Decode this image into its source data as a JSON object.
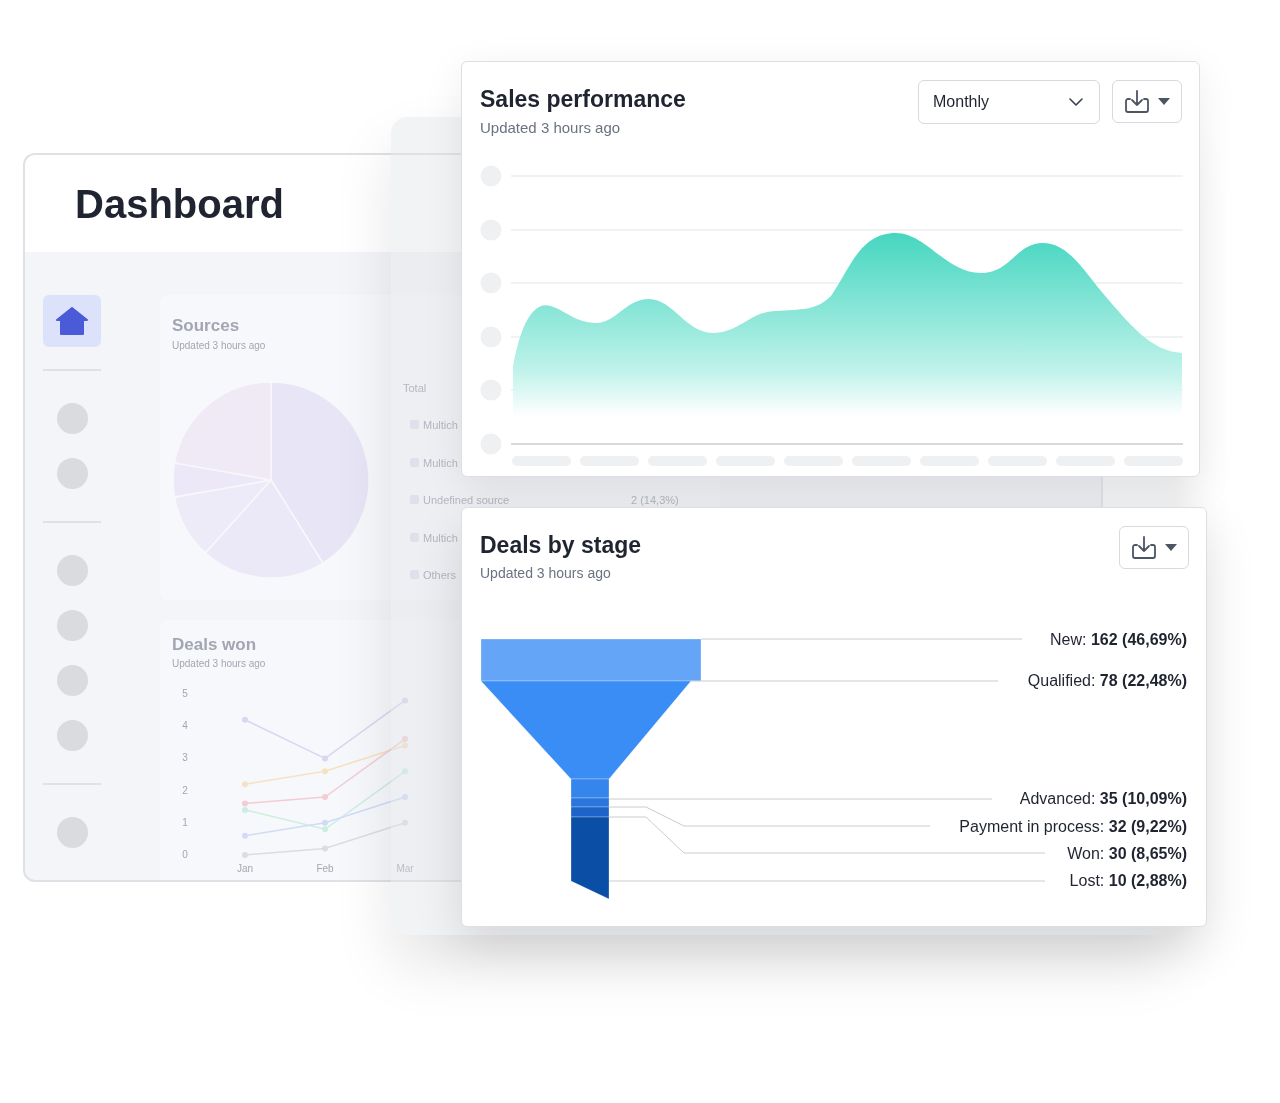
{
  "dashboard": {
    "title": "Dashboard",
    "sidebar": {
      "groups": [
        [
          {
            "kind": "home",
            "selected": true
          }
        ],
        [
          {
            "kind": "placeholder",
            "selected": false
          },
          {
            "kind": "placeholder",
            "selected": false
          }
        ],
        [
          {
            "kind": "placeholder",
            "selected": false
          },
          {
            "kind": "placeholder",
            "selected": false
          },
          {
            "kind": "placeholder",
            "selected": false
          },
          {
            "kind": "placeholder",
            "selected": false
          }
        ],
        [
          {
            "kind": "placeholder",
            "selected": false
          }
        ]
      ]
    },
    "sources": {
      "title": "Sources",
      "updated": "Updated 3 hours ago",
      "legend_title": "Total",
      "legend": [
        {
          "label": "Multich"
        },
        {
          "label": "Multich"
        },
        {
          "label": "Undefined source",
          "value": "2 (14,3%)"
        },
        {
          "label": "Multich"
        },
        {
          "label": "Others"
        }
      ]
    },
    "deals_won": {
      "title": "Deals won",
      "updated": "Updated 3 hours ago",
      "chart_data": {
        "type": "line",
        "categories": [
          "Jan",
          "Feb",
          "Mar"
        ],
        "yticks": [
          0,
          1,
          2,
          3,
          4,
          5
        ],
        "ylim": [
          0,
          5
        ],
        "series": [
          {
            "color": "#d9d6f2",
            "marker": "circle",
            "values": [
              4.2,
              3.0,
              4.8
            ]
          },
          {
            "color": "#f5e2c4",
            "marker": "circle",
            "values": [
              2.2,
              2.6,
              3.4
            ]
          },
          {
            "color": "#f3cdd3",
            "marker": "circle",
            "values": [
              1.6,
              1.8,
              3.6
            ]
          },
          {
            "color": "#cbeee1",
            "marker": "circle",
            "values": [
              1.4,
              0.8,
              2.6
            ]
          },
          {
            "color": "#d0dbf7",
            "marker": "circle",
            "values": [
              0.6,
              1.0,
              1.8
            ]
          },
          {
            "color": "#dcdde2",
            "marker": "circle",
            "values": [
              0,
              0.2,
              1.0
            ]
          }
        ]
      }
    }
  },
  "sales_performance": {
    "title": "Sales performance",
    "updated": "Updated 3 hours ago",
    "period_select": {
      "value": "Monthly"
    }
  },
  "deals_by_stage": {
    "title": "Deals by stage",
    "updated": "Updated 3 hours ago",
    "stages": [
      {
        "label": "New: **162 (46,69%)**"
      },
      {
        "label": "Qualified: **78 (22,48%)**"
      },
      {
        "label": "Advanced: **35 (10,09%)**"
      },
      {
        "label": "Payment in process: **32 (9,22%)**"
      },
      {
        "label": "Won: **30 (8,65%)**"
      },
      {
        "label": "Lost: **10 (2,88%)**"
      }
    ]
  }
}
